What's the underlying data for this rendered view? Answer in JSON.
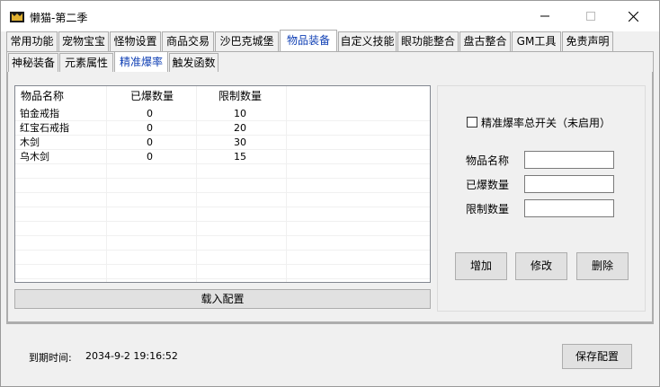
{
  "window": {
    "title": "懒猫-第二季",
    "minimize_glyph": "—",
    "maximize_glyph": "☐",
    "close_glyph": "✕"
  },
  "tabs_main": [
    {
      "label": "常用功能"
    },
    {
      "label": "宠物宝宝"
    },
    {
      "label": "怪物设置"
    },
    {
      "label": "商品交易"
    },
    {
      "label": "沙巴克城堡"
    },
    {
      "label": "物品装备",
      "active": true
    },
    {
      "label": "自定义技能"
    },
    {
      "label": "眼功能整合"
    },
    {
      "label": "盘古整合"
    },
    {
      "label": "GM工具"
    },
    {
      "label": "免责声明"
    }
  ],
  "tabs_sub": [
    {
      "label": "神秘装备"
    },
    {
      "label": "元素属性"
    },
    {
      "label": "精准爆率",
      "active": true
    },
    {
      "label": "触发函数"
    }
  ],
  "table": {
    "columns": [
      "物品名称",
      "已爆数量",
      "限制数量"
    ],
    "rows": [
      [
        "铂金戒指",
        "0",
        "10"
      ],
      [
        "红宝石戒指",
        "0",
        "20"
      ],
      [
        "木剑",
        "0",
        "30"
      ],
      [
        "乌木剑",
        "0",
        "15"
      ]
    ]
  },
  "load_button": "载入配置",
  "settings": {
    "master_switch_label": "精准爆率总开关（未启用）",
    "item_name_label": "物品名称",
    "dropped_label": "已爆数量",
    "limit_label": "限制数量",
    "add_button": "增加",
    "modify_button": "修改",
    "delete_button": "删除"
  },
  "footer": {
    "expiry_label": "到期时间:",
    "expiry_value": "2034-9-2 19:16:52",
    "save_button": "保存配置"
  }
}
